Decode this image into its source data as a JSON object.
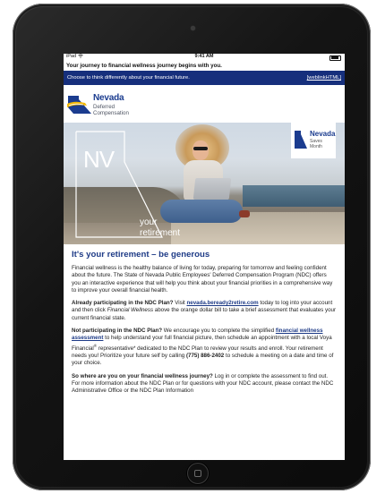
{
  "status_bar": {
    "carrier": "iPad",
    "time": "9:41 AM"
  },
  "email": {
    "subject": "Your journey to financial wellness journey begins with you.",
    "preheader": "Choose to think differently about your financial future.",
    "weblink": "[weblinkHTML]"
  },
  "logo": {
    "name": "Nevada",
    "line1": "Deferred",
    "line2": "Compensation"
  },
  "hero": {
    "monogram": "NV",
    "caption_line1": "your",
    "caption_line2": "retirement",
    "badge": {
      "name": "Nevada",
      "line1": "Saves",
      "line2": "Month"
    }
  },
  "article": {
    "heading": "It's your retirement – be generous",
    "p1": "Financial wellness is the healthy balance of living for today, preparing for tomorrow and feeling confident about the future. The State of Nevada Public Employees' Deferred Compensation Program (NDC) offers you an interactive experience that will help you think about your financial priorities in a comprehensive way to improve your overall financial health.",
    "p2_lead": "Already participating in the NDC Plan?",
    "p2_a": " Visit ",
    "p2_link": "nevada.beready2retire.com",
    "p2_b": " today to log into your account and then click ",
    "p2_italic": "Financial Wellness",
    "p2_c": " above the orange dollar bill to take a brief assessment that evaluates your current financial state.",
    "p3_lead": "Not participating in the NDC Plan?",
    "p3_a": " We encourage you to complete the simplified ",
    "p3_link": "financial wellness assessment",
    "p3_b": " to help understand your full financial picture, then schedule an appointment with a local Voya Financial",
    "p3_sup": "®",
    "p3_c": " representative* dedicated to the NDC Plan to review your results and enroll. Your retirement needs you! Prioritize your future self by calling ",
    "p3_phone": "(775) 886-2402",
    "p3_d": " to schedule a meeting on a date and time of your choice.",
    "p4_lead": "So where are you on your financial wellness journey?",
    "p4_a": " Log in or complete the assessment to find out. For more information about the NDC Plan or for questions with your NDC account, please contact the NDC Administrative Office or the NDC Plan Information"
  },
  "colors": {
    "navy": "#162f7c",
    "brand_blue": "#1b3c8f",
    "gold": "#f2b705"
  }
}
